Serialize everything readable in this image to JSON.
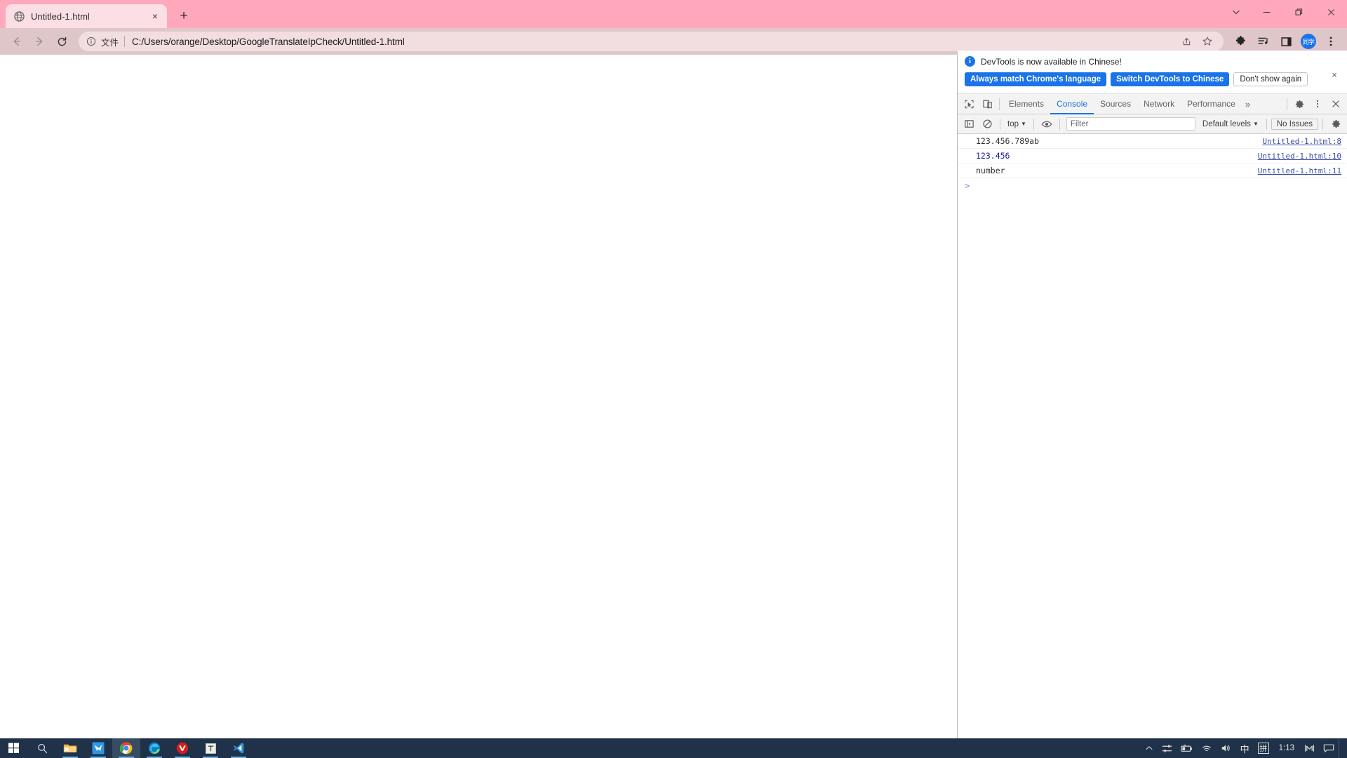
{
  "browser": {
    "tab": {
      "title": "Untitled-1.html",
      "favicon": "globe-icon",
      "close": "×"
    },
    "newtab_label": "+",
    "window_controls": {
      "tab_search": "tab-search-chevron-icon",
      "minimize": "minimize-icon",
      "maximize": "maximize-icon",
      "close": "close-icon"
    },
    "nav": {
      "back": "back-arrow-icon",
      "forward": "forward-arrow-icon",
      "reload": "reload-icon"
    },
    "omnibox": {
      "info_icon": "info-circle-icon",
      "scheme_label": "文件",
      "url": "C:/Users/orange/Desktop/GoogleTranslateIpCheck/Untitled-1.html",
      "share_icon": "share-icon",
      "bookmark_icon": "star-icon"
    },
    "toolbar_icons": [
      {
        "name": "extensions-puzzle-icon",
        "glyph": "puzzle"
      },
      {
        "name": "media-playlist-icon",
        "glyph": "playlist"
      },
      {
        "name": "side-panel-icon",
        "glyph": "panel"
      }
    ],
    "profile": {
      "name": "profile-avatar",
      "initials": "同学",
      "color": "#1a73e8"
    },
    "menu_icon": "three-dot-menu-icon",
    "colors": {
      "tabstrip": "#ffa8bc",
      "toolbar": "#dfc6c9",
      "omnibox": "#f2dde0"
    }
  },
  "devtools": {
    "notice": {
      "icon": "info-badge-icon",
      "message": "DevTools is now available in Chinese!",
      "buttons": [
        {
          "label": "Always match Chrome's language",
          "style": "primary"
        },
        {
          "label": "Switch DevTools to Chinese",
          "style": "primary"
        },
        {
          "label": "Don't show again",
          "style": "secondary"
        }
      ],
      "close": "×"
    },
    "tabbar": {
      "inspect_icon": "inspect-cursor-icon",
      "device_icon": "device-toolbar-icon",
      "tabs": [
        {
          "label": "Elements",
          "active": false
        },
        {
          "label": "Console",
          "active": true
        },
        {
          "label": "Sources",
          "active": false
        },
        {
          "label": "Network",
          "active": false
        },
        {
          "label": "Performance",
          "active": false
        }
      ],
      "overflow": "»",
      "settings_icon": "gear-icon",
      "more_icon": "three-dot-vertical-icon",
      "close_icon": "close-devtools-icon"
    },
    "filterbar": {
      "sidebar_icon": "console-sidebar-icon",
      "clear_icon": "clear-console-icon",
      "context": "top",
      "context_caret": "▼",
      "eye_icon": "live-expression-eye-icon",
      "filter_placeholder": "Filter",
      "filter_value": "",
      "levels_label": "Default levels",
      "levels_caret": "▼",
      "issues_label": "No Issues",
      "settings_icon": "console-settings-gear-icon"
    },
    "console": {
      "messages": [
        {
          "text": "123.456.789ab",
          "type": "string",
          "source": "Untitled-1.html:8"
        },
        {
          "text": "123.456",
          "type": "number",
          "source": "Untitled-1.html:10"
        },
        {
          "text": "number",
          "type": "string",
          "source": "Untitled-1.html:11"
        }
      ],
      "prompt_caret": ">"
    }
  },
  "taskbar": {
    "apps": [
      {
        "name": "start-button",
        "glyph": "windows",
        "running": false,
        "active": false
      },
      {
        "name": "search-button",
        "glyph": "search",
        "running": false,
        "active": false
      },
      {
        "name": "file-explorer-icon",
        "glyph": "folder",
        "running": true,
        "active": false
      },
      {
        "name": "bird-app-icon",
        "glyph": "bird",
        "running": true,
        "active": false
      },
      {
        "name": "chrome-icon",
        "glyph": "chrome",
        "running": true,
        "active": true
      },
      {
        "name": "edge-icon",
        "glyph": "edge",
        "running": true,
        "active": false
      },
      {
        "name": "vivaldi-icon",
        "glyph": "vivaldi",
        "running": true,
        "active": false
      },
      {
        "name": "typora-icon",
        "glyph": "t-doc",
        "running": true,
        "active": false
      },
      {
        "name": "vscode-icon",
        "glyph": "vscode",
        "running": true,
        "active": false
      }
    ],
    "tray": {
      "overflow": "^",
      "items": [
        {
          "name": "network-sliders-icon",
          "glyph": "sliders"
        },
        {
          "name": "battery-icon",
          "glyph": "battery"
        },
        {
          "name": "wifi-icon",
          "glyph": "wifi"
        },
        {
          "name": "volume-icon",
          "glyph": "volume"
        }
      ],
      "ime_mode": "中",
      "ime_pinyin": "拼",
      "clock": "1:13",
      "extra_icon": "m-meter-icon",
      "action_center": "notification-icon"
    }
  }
}
